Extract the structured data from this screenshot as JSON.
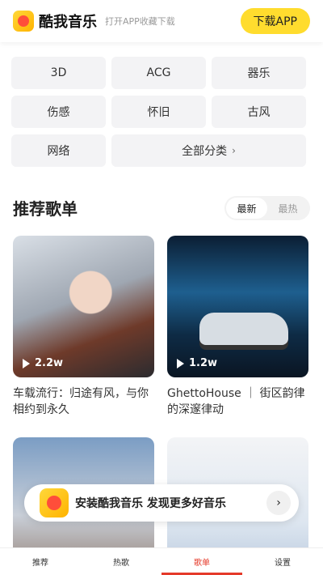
{
  "header": {
    "brand": "酷我音乐",
    "slogan": "打开APP收藏下载",
    "download_label": "下载APP"
  },
  "categories": [
    "3D",
    "ACG",
    "器乐",
    "伤感",
    "怀旧",
    "古风",
    "网络"
  ],
  "all_categories_label": "全部分类",
  "section": {
    "title": "推荐歌单",
    "sort_options": [
      "最新",
      "最热"
    ],
    "selected_sort": "最新"
  },
  "playlists": [
    {
      "title": "车载流行：归途有风，与你相约到永久",
      "plays": "2.2w"
    },
    {
      "title": "GhettoHouse ｜ 街区韵律的深邃律动",
      "plays": "1.2w"
    },
    {
      "title": "",
      "plays": ""
    },
    {
      "title": "",
      "plays": ""
    }
  ],
  "banner": {
    "text": "安装酷我音乐 发现更多好音乐"
  },
  "tabs": [
    "推荐",
    "热歌",
    "歌单",
    "设置"
  ],
  "active_tab": "歌单",
  "colors": {
    "accent": "#ffdc2e",
    "active_tab": "#e53a2a"
  }
}
